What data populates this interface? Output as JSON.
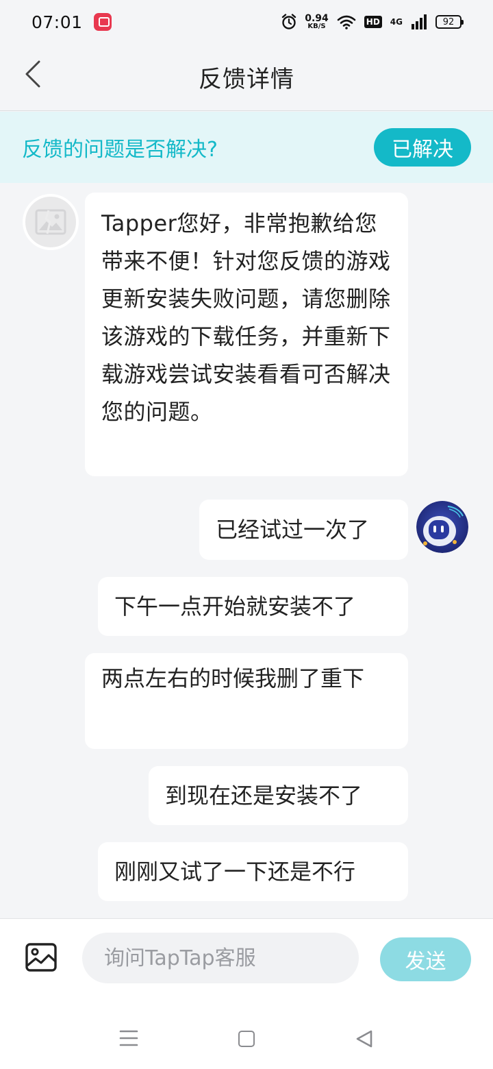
{
  "status_bar": {
    "time": "07:01",
    "net_speed_value": "0.94",
    "net_speed_unit": "KB/S",
    "hd_label": "HD",
    "network_label": "4G",
    "battery_level": "92",
    "icons": [
      "app-notification-icon",
      "alarm-icon",
      "wifi-icon",
      "signal-icon",
      "battery-icon"
    ]
  },
  "header": {
    "title": "反馈详情",
    "back_icon": "chevron-left-icon"
  },
  "resolve_banner": {
    "question": "反馈的问题是否解决?",
    "resolved_label": "已解决"
  },
  "chat": {
    "support_message": "Tapper您好，非常抱歉给您带来不便！针对您反馈的游戏更新安装失败问题，请您删除该游戏的下载任务，并重新下载游戏尝试安装看看可否解决您的问题。",
    "user_messages": [
      "已经试过一次了",
      "下午一点开始就安装不了",
      "两点左右的时候我删了重下",
      "到现在还是安装不了",
      "刚刚又试了一下还是不行"
    ]
  },
  "input_bar": {
    "placeholder": "询问TapTap客服",
    "send_label": "发送",
    "image_icon": "image-icon"
  },
  "nav_bar": {
    "icons": [
      "menu-icon",
      "home-icon",
      "back-triangle-icon"
    ]
  },
  "colors": {
    "accent": "#14b9c8",
    "banner_bg": "#e3f6f8",
    "send_disabled": "#8ddbe3",
    "page_bg": "#f4f5f7"
  }
}
